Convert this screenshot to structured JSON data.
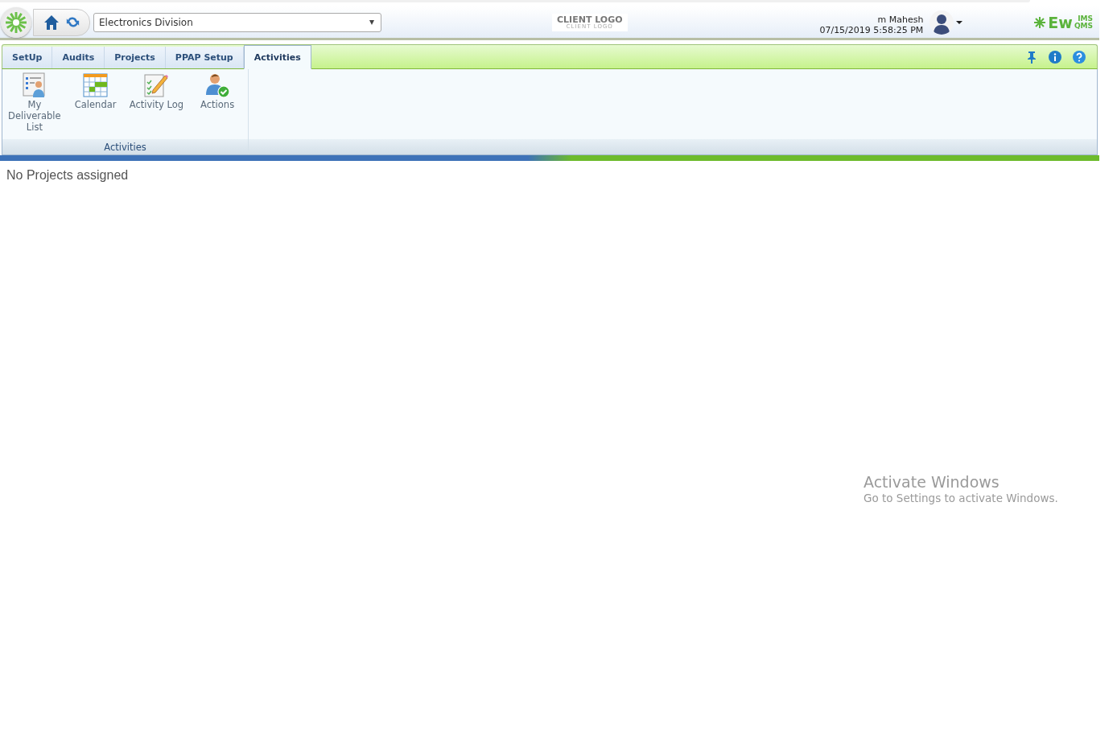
{
  "header": {
    "division": "Electronics Division",
    "client_logo": {
      "title": "CLIENT LOGO",
      "subtitle": "CLIENT LOGO"
    },
    "user": "m Mahesh",
    "datetime": "07/15/2019 5:58:25 PM",
    "brand": {
      "main": "Ew",
      "top": "IMS",
      "bottom": "QMS"
    }
  },
  "tabs": [
    {
      "label": "SetUp",
      "selected": false
    },
    {
      "label": "Audits",
      "selected": false
    },
    {
      "label": "Projects",
      "selected": false
    },
    {
      "label": "PPAP Setup",
      "selected": false
    },
    {
      "label": "Activities",
      "selected": true
    }
  ],
  "ribbon": {
    "group": "Activities",
    "items": [
      {
        "label": "My Deliverable List",
        "kind": "deliverables"
      },
      {
        "label": "Calendar",
        "kind": "calendar"
      },
      {
        "label": "Activity Log",
        "kind": "log"
      },
      {
        "label": "Actions",
        "kind": "actions"
      }
    ]
  },
  "message": "No Projects assigned",
  "os_notice": {
    "title": "Activate Windows",
    "text": "Go to Settings to activate Windows."
  }
}
